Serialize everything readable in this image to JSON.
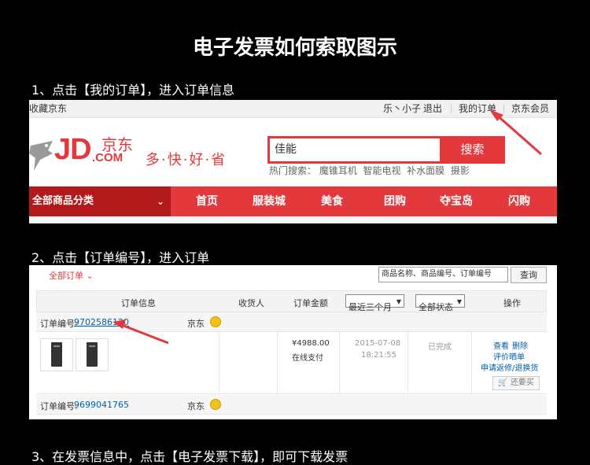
{
  "title": "电子发票如何索取图示",
  "steps": {
    "s1": "1、点击【我的订单】，进入订单信息",
    "s2": "2、点击【订单编号】，进入订单",
    "s3": "3、在发票信息中，点击【电子发票下载】，即可下载发票"
  },
  "jd": {
    "top_left": "收藏京东",
    "user": "乐丶小子",
    "logout": "退出",
    "my_orders": "我的订单",
    "member": "京东会员",
    "logo_text": "JD",
    "logo_cn": "京东",
    "logo_com": ".COM",
    "slogan": "多·快·好·省",
    "search_value": "佳能",
    "search_button": "搜索",
    "hot_label": "热门搜索：",
    "hot_items": [
      "魔锥耳机",
      "智能电视",
      "补水面膜",
      "摄影"
    ],
    "nav_category": "全部商品分类",
    "nav_items": [
      "首页",
      "服装城",
      "美食",
      "团购",
      "夺宝岛",
      "闪购"
    ]
  },
  "orders": {
    "filter_label": "全部订单",
    "search_placeholder": "商品名称、商品编号、订单编号",
    "search_button": "查询",
    "headers": {
      "info": "订单信息",
      "recipient": "收货人",
      "amount": "订单金额",
      "time_filter": "最近三个月",
      "status_filter": "全部状态",
      "actions": "操作"
    },
    "order1": {
      "label": "订单编号:",
      "number": "9702586120",
      "shop": "京东",
      "price": "¥4988.00",
      "payment": "在线支付",
      "date": "2015-07-08",
      "time": "18:21:55",
      "status": "已完成",
      "actions": [
        "查看",
        "删除",
        "评价晒单",
        "申请返修/退换货"
      ],
      "rebuy": "还要买"
    },
    "order2": {
      "label": "订单编号:",
      "number": "9699041765",
      "shop": "京东"
    }
  },
  "colors": {
    "jd_red": "#e4393c",
    "link_blue": "#005ea7"
  }
}
